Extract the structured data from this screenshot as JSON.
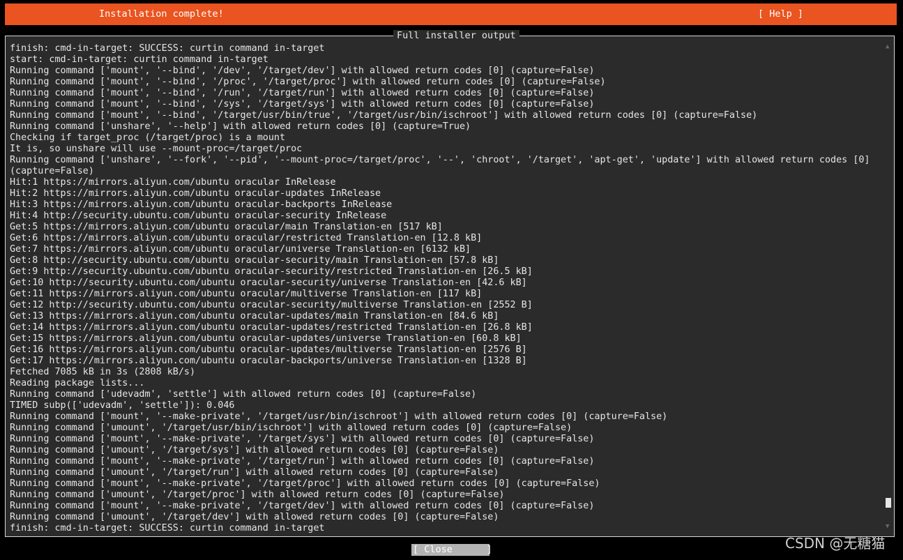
{
  "header": {
    "title": "Installation complete!",
    "help_label": "[ Help ]"
  },
  "panel": {
    "title": "Full installer output"
  },
  "log_lines": [
    "finish: cmd-in-target: SUCCESS: curtin command in-target",
    "start: cmd-in-target: curtin command in-target",
    "Running command ['mount', '--bind', '/dev', '/target/dev'] with allowed return codes [0] (capture=False)",
    "Running command ['mount', '--bind', '/proc', '/target/proc'] with allowed return codes [0] (capture=False)",
    "Running command ['mount', '--bind', '/run', '/target/run'] with allowed return codes [0] (capture=False)",
    "Running command ['mount', '--bind', '/sys', '/target/sys'] with allowed return codes [0] (capture=False)",
    "Running command ['mount', '--bind', '/target/usr/bin/true', '/target/usr/bin/ischroot'] with allowed return codes [0] (capture=False)",
    "Running command ['unshare', '--help'] with allowed return codes [0] (capture=True)",
    "Checking if target_proc (/target/proc) is a mount",
    "It is, so unshare will use --mount-proc=/target/proc",
    "Running command ['unshare', '--fork', '--pid', '--mount-proc=/target/proc', '--', 'chroot', '/target', 'apt-get', 'update'] with allowed return codes [0]",
    "(capture=False)",
    "Hit:1 https://mirrors.aliyun.com/ubuntu oracular InRelease",
    "Hit:2 https://mirrors.aliyun.com/ubuntu oracular-updates InRelease",
    "Hit:3 https://mirrors.aliyun.com/ubuntu oracular-backports InRelease",
    "Hit:4 http://security.ubuntu.com/ubuntu oracular-security InRelease",
    "Get:5 https://mirrors.aliyun.com/ubuntu oracular/main Translation-en [517 kB]",
    "Get:6 https://mirrors.aliyun.com/ubuntu oracular/restricted Translation-en [12.8 kB]",
    "Get:7 https://mirrors.aliyun.com/ubuntu oracular/universe Translation-en [6132 kB]",
    "Get:8 http://security.ubuntu.com/ubuntu oracular-security/main Translation-en [57.8 kB]",
    "Get:9 http://security.ubuntu.com/ubuntu oracular-security/restricted Translation-en [26.5 kB]",
    "Get:10 http://security.ubuntu.com/ubuntu oracular-security/universe Translation-en [42.6 kB]",
    "Get:11 https://mirrors.aliyun.com/ubuntu oracular/multiverse Translation-en [117 kB]",
    "Get:12 http://security.ubuntu.com/ubuntu oracular-security/multiverse Translation-en [2552 B]",
    "Get:13 https://mirrors.aliyun.com/ubuntu oracular-updates/main Translation-en [84.6 kB]",
    "Get:14 https://mirrors.aliyun.com/ubuntu oracular-updates/restricted Translation-en [26.8 kB]",
    "Get:15 https://mirrors.aliyun.com/ubuntu oracular-updates/universe Translation-en [60.8 kB]",
    "Get:16 https://mirrors.aliyun.com/ubuntu oracular-updates/multiverse Translation-en [2576 B]",
    "Get:17 https://mirrors.aliyun.com/ubuntu oracular-backports/universe Translation-en [1328 B]",
    "Fetched 7085 kB in 3s (2808 kB/s)",
    "Reading package lists...",
    "Running command ['udevadm', 'settle'] with allowed return codes [0] (capture=False)",
    "TIMED subp(['udevadm', 'settle']): 0.046",
    "Running command ['mount', '--make-private', '/target/usr/bin/ischroot'] with allowed return codes [0] (capture=False)",
    "Running command ['umount', '/target/usr/bin/ischroot'] with allowed return codes [0] (capture=False)",
    "Running command ['mount', '--make-private', '/target/sys'] with allowed return codes [0] (capture=False)",
    "Running command ['umount', '/target/sys'] with allowed return codes [0] (capture=False)",
    "Running command ['mount', '--make-private', '/target/run'] with allowed return codes [0] (capture=False)",
    "Running command ['umount', '/target/run'] with allowed return codes [0] (capture=False)",
    "Running command ['mount', '--make-private', '/target/proc'] with allowed return codes [0] (capture=False)",
    "Running command ['umount', '/target/proc'] with allowed return codes [0] (capture=False)",
    "Running command ['mount', '--make-private', '/target/dev'] with allowed return codes [0] (capture=False)",
    "Running command ['umount', '/target/dev'] with allowed return codes [0] (capture=False)",
    "finish: cmd-in-target: SUCCESS: curtin command in-target"
  ],
  "scrollbar": {
    "up_arrow": "▲",
    "down_arrow": "▼",
    "position": 0.97
  },
  "footer": {
    "close_label": "[ Close      ]"
  },
  "watermark": {
    "text": "CSDN @无糖猫"
  },
  "colors": {
    "accent": "#e95420",
    "background": "#000000",
    "panel": "#2b2b2b",
    "text": "#e6e6e6",
    "button": "#b3b3b3"
  }
}
